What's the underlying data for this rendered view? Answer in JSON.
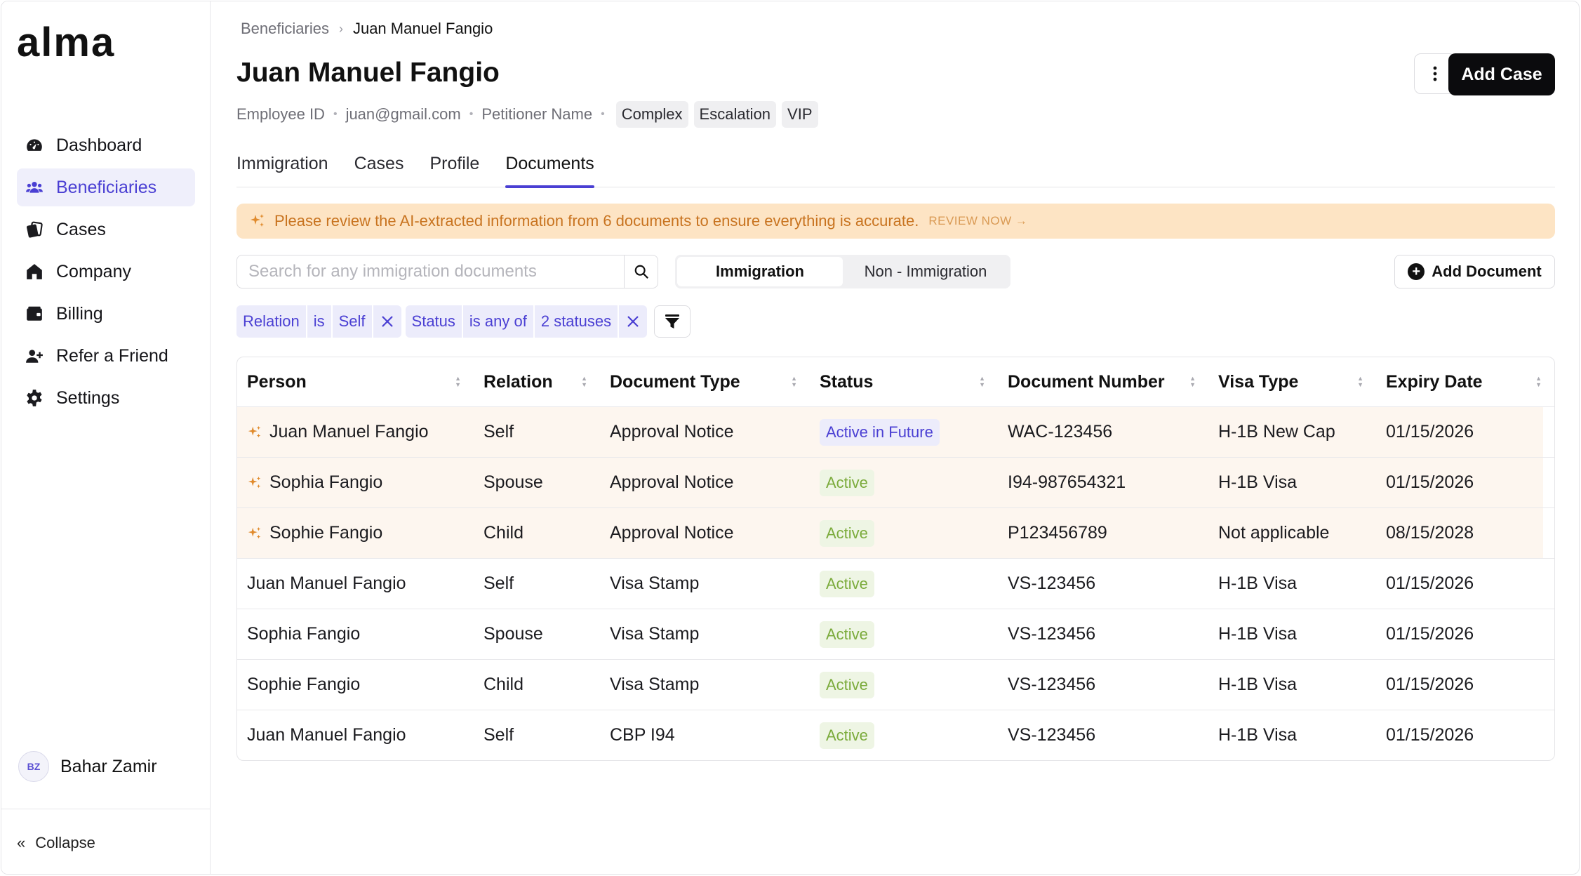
{
  "brand": {
    "logo": "alma"
  },
  "sidebar": {
    "items": [
      {
        "label": "Dashboard",
        "icon": "dashboard-icon"
      },
      {
        "label": "Beneficiaries",
        "icon": "people-icon",
        "active": true
      },
      {
        "label": "Cases",
        "icon": "cases-icon"
      },
      {
        "label": "Company",
        "icon": "home-icon"
      },
      {
        "label": "Billing",
        "icon": "wallet-icon"
      },
      {
        "label": "Refer a Friend",
        "icon": "add-user-icon"
      },
      {
        "label": "Settings",
        "icon": "gear-icon"
      }
    ],
    "user": {
      "initials": "BZ",
      "name": "Bahar Zamir"
    },
    "collapse_label": "Collapse"
  },
  "breadcrumb": {
    "parent": "Beneficiaries",
    "current": "Juan Manuel Fangio"
  },
  "header": {
    "title": "Juan Manuel Fangio",
    "add_case_label": "Add Case",
    "meta": {
      "employee_id": "Employee ID",
      "email": "juan@gmail.com",
      "petitioner": "Petitioner Name"
    },
    "tags": [
      "Complex",
      "Escalation",
      "VIP"
    ]
  },
  "tabs": [
    {
      "label": "Immigration"
    },
    {
      "label": "Cases"
    },
    {
      "label": "Profile"
    },
    {
      "label": "Documents",
      "active": true
    }
  ],
  "banner": {
    "text": "Please review the AI-extracted information from 6 documents to ensure everything is accurate.",
    "link": "REVIEW NOW"
  },
  "toolbar": {
    "search_placeholder": "Search for any immigration documents",
    "segments": [
      {
        "label": "Immigration",
        "active": true
      },
      {
        "label": "Non - Immigration"
      }
    ],
    "add_document_label": "Add Document"
  },
  "filters": [
    {
      "field": "Relation",
      "op": "is",
      "value": "Self"
    },
    {
      "field": "Status",
      "op": "is any of",
      "value": "2 statuses"
    }
  ],
  "table": {
    "columns": [
      "Person",
      "Relation",
      "Document Type",
      "Status",
      "Document Number",
      "Visa Type",
      "Expiry Date"
    ],
    "rows": [
      {
        "ai": true,
        "person": "Juan Manuel Fangio",
        "relation": "Self",
        "doc_type": "Approval Notice",
        "status": "Active in Future",
        "status_kind": "future",
        "doc_number": "WAC-123456",
        "visa": "H-1B New Cap",
        "expiry": "01/15/2026"
      },
      {
        "ai": true,
        "person": "Sophia Fangio",
        "relation": "Spouse",
        "doc_type": "Approval Notice",
        "status": "Active",
        "status_kind": "active",
        "doc_number": "I94-987654321",
        "visa": "H-1B Visa",
        "expiry": "01/15/2026"
      },
      {
        "ai": true,
        "person": "Sophie Fangio",
        "relation": "Child",
        "doc_type": "Approval Notice",
        "status": "Active",
        "status_kind": "active",
        "doc_number": "P123456789",
        "visa": "Not applicable",
        "expiry": "08/15/2028"
      },
      {
        "ai": false,
        "person": "Juan Manuel Fangio",
        "relation": "Self",
        "doc_type": "Visa Stamp",
        "status": "Active",
        "status_kind": "active",
        "doc_number": "VS-123456",
        "visa": "H-1B Visa",
        "expiry": "01/15/2026"
      },
      {
        "ai": false,
        "person": "Sophia Fangio",
        "relation": "Spouse",
        "doc_type": "Visa Stamp",
        "status": "Active",
        "status_kind": "active",
        "doc_number": "VS-123456",
        "visa": "H-1B Visa",
        "expiry": "01/15/2026"
      },
      {
        "ai": false,
        "person": "Sophie Fangio",
        "relation": "Child",
        "doc_type": "Visa Stamp",
        "status": "Active",
        "status_kind": "active",
        "doc_number": "VS-123456",
        "visa": "H-1B Visa",
        "expiry": "01/15/2026"
      },
      {
        "ai": false,
        "person": "Juan Manuel Fangio",
        "relation": "Self",
        "doc_type": "CBP I94",
        "status": "Active",
        "status_kind": "active",
        "doc_number": "VS-123456",
        "visa": "H-1B Visa",
        "expiry": "01/15/2026"
      }
    ]
  },
  "colors": {
    "accent": "#4a3fd3",
    "banner_bg": "#fde4c4",
    "banner_text": "#c8731f",
    "active_green": "#7bab3c",
    "ai_spark": "#e08a2c"
  }
}
